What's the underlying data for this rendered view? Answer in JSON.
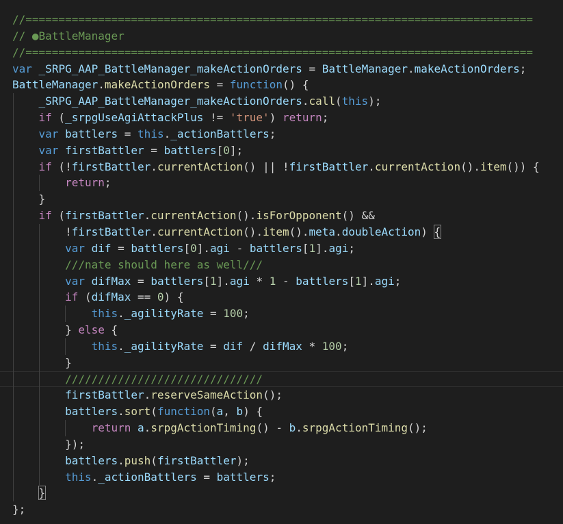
{
  "editor": {
    "language": "javascript",
    "theme": "Dark+",
    "background": "#1e1e1e",
    "colors": {
      "comment": "#6a9955",
      "keyword": "#569cd6",
      "control": "#c586c0",
      "variable": "#9cdcfe",
      "function": "#dcdcaa",
      "string": "#ce9178",
      "number": "#b5cea8",
      "type": "#4ec9b0",
      "plain": "#d4d4d4"
    },
    "lines": [
      {
        "indent": 0,
        "tokens": [
          {
            "t": "//=============================================================================",
            "c": "comment"
          }
        ]
      },
      {
        "indent": 0,
        "tokens": [
          {
            "t": "// ●BattleManager",
            "c": "comment"
          }
        ]
      },
      {
        "indent": 0,
        "tokens": [
          {
            "t": "//=============================================================================",
            "c": "comment"
          }
        ]
      },
      {
        "indent": 0,
        "tokens": [
          {
            "t": "var",
            "c": "keyword"
          },
          {
            "t": " ",
            "c": "plain"
          },
          {
            "t": "_SRPG_AAP_BattleManager_makeActionOrders",
            "c": "variable"
          },
          {
            "t": " = ",
            "c": "plain"
          },
          {
            "t": "BattleManager",
            "c": "variable"
          },
          {
            "t": ".",
            "c": "plain"
          },
          {
            "t": "makeActionOrders",
            "c": "variable"
          },
          {
            "t": ";",
            "c": "plain"
          }
        ]
      },
      {
        "indent": 0,
        "tokens": [
          {
            "t": "BattleManager",
            "c": "variable"
          },
          {
            "t": ".",
            "c": "plain"
          },
          {
            "t": "makeActionOrders",
            "c": "function"
          },
          {
            "t": " = ",
            "c": "plain"
          },
          {
            "t": "function",
            "c": "keyword"
          },
          {
            "t": "() {",
            "c": "plain"
          }
        ]
      },
      {
        "indent": 1,
        "tokens": [
          {
            "t": "_SRPG_AAP_BattleManager_makeActionOrders",
            "c": "variable"
          },
          {
            "t": ".",
            "c": "plain"
          },
          {
            "t": "call",
            "c": "function"
          },
          {
            "t": "(",
            "c": "plain"
          },
          {
            "t": "this",
            "c": "keyword"
          },
          {
            "t": ");",
            "c": "plain"
          }
        ]
      },
      {
        "indent": 1,
        "tokens": [
          {
            "t": "if",
            "c": "control"
          },
          {
            "t": " (",
            "c": "plain"
          },
          {
            "t": "_srpgUseAgiAttackPlus",
            "c": "variable"
          },
          {
            "t": " != ",
            "c": "plain"
          },
          {
            "t": "'true'",
            "c": "string"
          },
          {
            "t": ") ",
            "c": "plain"
          },
          {
            "t": "return",
            "c": "control"
          },
          {
            "t": ";",
            "c": "plain"
          }
        ]
      },
      {
        "indent": 1,
        "tokens": [
          {
            "t": "var",
            "c": "keyword"
          },
          {
            "t": " ",
            "c": "plain"
          },
          {
            "t": "battlers",
            "c": "variable"
          },
          {
            "t": " = ",
            "c": "plain"
          },
          {
            "t": "this",
            "c": "keyword"
          },
          {
            "t": ".",
            "c": "plain"
          },
          {
            "t": "_actionBattlers",
            "c": "variable"
          },
          {
            "t": ";",
            "c": "plain"
          }
        ]
      },
      {
        "indent": 1,
        "tokens": [
          {
            "t": "var",
            "c": "keyword"
          },
          {
            "t": " ",
            "c": "plain"
          },
          {
            "t": "firstBattler",
            "c": "variable"
          },
          {
            "t": " = ",
            "c": "plain"
          },
          {
            "t": "battlers",
            "c": "variable"
          },
          {
            "t": "[",
            "c": "plain"
          },
          {
            "t": "0",
            "c": "number"
          },
          {
            "t": "];",
            "c": "plain"
          }
        ]
      },
      {
        "indent": 1,
        "tokens": [
          {
            "t": "if",
            "c": "control"
          },
          {
            "t": " (!",
            "c": "plain"
          },
          {
            "t": "firstBattler",
            "c": "variable"
          },
          {
            "t": ".",
            "c": "plain"
          },
          {
            "t": "currentAction",
            "c": "function"
          },
          {
            "t": "() || !",
            "c": "plain"
          },
          {
            "t": "firstBattler",
            "c": "variable"
          },
          {
            "t": ".",
            "c": "plain"
          },
          {
            "t": "currentAction",
            "c": "function"
          },
          {
            "t": "().",
            "c": "plain"
          },
          {
            "t": "item",
            "c": "function"
          },
          {
            "t": "()) {",
            "c": "plain"
          }
        ]
      },
      {
        "indent": 2,
        "tokens": [
          {
            "t": "return",
            "c": "control"
          },
          {
            "t": ";",
            "c": "plain"
          }
        ]
      },
      {
        "indent": 1,
        "tokens": [
          {
            "t": "}",
            "c": "plain"
          }
        ]
      },
      {
        "indent": 1,
        "tokens": [
          {
            "t": "if",
            "c": "control"
          },
          {
            "t": " (",
            "c": "plain"
          },
          {
            "t": "firstBattler",
            "c": "variable"
          },
          {
            "t": ".",
            "c": "plain"
          },
          {
            "t": "currentAction",
            "c": "function"
          },
          {
            "t": "().",
            "c": "plain"
          },
          {
            "t": "isForOpponent",
            "c": "function"
          },
          {
            "t": "() &&",
            "c": "plain"
          }
        ]
      },
      {
        "indent": 2,
        "tokens": [
          {
            "t": "!",
            "c": "plain"
          },
          {
            "t": "firstBattler",
            "c": "variable"
          },
          {
            "t": ".",
            "c": "plain"
          },
          {
            "t": "currentAction",
            "c": "function"
          },
          {
            "t": "().",
            "c": "plain"
          },
          {
            "t": "item",
            "c": "function"
          },
          {
            "t": "().",
            "c": "plain"
          },
          {
            "t": "meta",
            "c": "variable"
          },
          {
            "t": ".",
            "c": "plain"
          },
          {
            "t": "doubleAction",
            "c": "variable"
          },
          {
            "t": ") ",
            "c": "plain"
          },
          {
            "t": "{",
            "c": "plain",
            "hl": true
          }
        ]
      },
      {
        "indent": 2,
        "tokens": [
          {
            "t": "var",
            "c": "keyword"
          },
          {
            "t": " ",
            "c": "plain"
          },
          {
            "t": "dif",
            "c": "variable"
          },
          {
            "t": " = ",
            "c": "plain"
          },
          {
            "t": "battlers",
            "c": "variable"
          },
          {
            "t": "[",
            "c": "plain"
          },
          {
            "t": "0",
            "c": "number"
          },
          {
            "t": "].",
            "c": "plain"
          },
          {
            "t": "agi",
            "c": "variable"
          },
          {
            "t": " - ",
            "c": "plain"
          },
          {
            "t": "battlers",
            "c": "variable"
          },
          {
            "t": "[",
            "c": "plain"
          },
          {
            "t": "1",
            "c": "number"
          },
          {
            "t": "].",
            "c": "plain"
          },
          {
            "t": "agi",
            "c": "variable"
          },
          {
            "t": ";",
            "c": "plain"
          }
        ]
      },
      {
        "indent": 2,
        "tokens": [
          {
            "t": "///nate should here as well///",
            "c": "comment"
          }
        ]
      },
      {
        "indent": 2,
        "tokens": [
          {
            "t": "var",
            "c": "keyword"
          },
          {
            "t": " ",
            "c": "plain"
          },
          {
            "t": "difMax",
            "c": "variable"
          },
          {
            "t": " = ",
            "c": "plain"
          },
          {
            "t": "battlers",
            "c": "variable"
          },
          {
            "t": "[",
            "c": "plain"
          },
          {
            "t": "1",
            "c": "number"
          },
          {
            "t": "].",
            "c": "plain"
          },
          {
            "t": "agi",
            "c": "variable"
          },
          {
            "t": " * ",
            "c": "plain"
          },
          {
            "t": "1",
            "c": "number"
          },
          {
            "t": " - ",
            "c": "plain"
          },
          {
            "t": "battlers",
            "c": "variable"
          },
          {
            "t": "[",
            "c": "plain"
          },
          {
            "t": "1",
            "c": "number"
          },
          {
            "t": "].",
            "c": "plain"
          },
          {
            "t": "agi",
            "c": "variable"
          },
          {
            "t": ";",
            "c": "plain"
          }
        ]
      },
      {
        "indent": 2,
        "tokens": [
          {
            "t": "if",
            "c": "control"
          },
          {
            "t": " (",
            "c": "plain"
          },
          {
            "t": "difMax",
            "c": "variable"
          },
          {
            "t": " == ",
            "c": "plain"
          },
          {
            "t": "0",
            "c": "number"
          },
          {
            "t": ") {",
            "c": "plain"
          }
        ]
      },
      {
        "indent": 3,
        "tokens": [
          {
            "t": "this",
            "c": "keyword"
          },
          {
            "t": ".",
            "c": "plain"
          },
          {
            "t": "_agilityRate",
            "c": "variable"
          },
          {
            "t": " = ",
            "c": "plain"
          },
          {
            "t": "100",
            "c": "number"
          },
          {
            "t": ";",
            "c": "plain"
          }
        ]
      },
      {
        "indent": 2,
        "tokens": [
          {
            "t": "} ",
            "c": "plain"
          },
          {
            "t": "else",
            "c": "control"
          },
          {
            "t": " {",
            "c": "plain"
          }
        ]
      },
      {
        "indent": 3,
        "tokens": [
          {
            "t": "this",
            "c": "keyword"
          },
          {
            "t": ".",
            "c": "plain"
          },
          {
            "t": "_agilityRate",
            "c": "variable"
          },
          {
            "t": " = ",
            "c": "plain"
          },
          {
            "t": "dif",
            "c": "variable"
          },
          {
            "t": " / ",
            "c": "plain"
          },
          {
            "t": "difMax",
            "c": "variable"
          },
          {
            "t": " * ",
            "c": "plain"
          },
          {
            "t": "100",
            "c": "number"
          },
          {
            "t": ";",
            "c": "plain"
          }
        ]
      },
      {
        "indent": 2,
        "tokens": [
          {
            "t": "}",
            "c": "plain"
          }
        ]
      },
      {
        "indent": 2,
        "current": true,
        "tokens": [
          {
            "t": "//////////////////////////////",
            "c": "comment"
          }
        ]
      },
      {
        "indent": 2,
        "tokens": [
          {
            "t": "firstBattler",
            "c": "variable"
          },
          {
            "t": ".",
            "c": "plain"
          },
          {
            "t": "reserveSameAction",
            "c": "function"
          },
          {
            "t": "();",
            "c": "plain"
          }
        ]
      },
      {
        "indent": 2,
        "tokens": [
          {
            "t": "battlers",
            "c": "variable"
          },
          {
            "t": ".",
            "c": "plain"
          },
          {
            "t": "sort",
            "c": "function"
          },
          {
            "t": "(",
            "c": "plain"
          },
          {
            "t": "function",
            "c": "keyword"
          },
          {
            "t": "(",
            "c": "plain"
          },
          {
            "t": "a",
            "c": "variable"
          },
          {
            "t": ", ",
            "c": "plain"
          },
          {
            "t": "b",
            "c": "variable"
          },
          {
            "t": ") {",
            "c": "plain"
          }
        ]
      },
      {
        "indent": 3,
        "tokens": [
          {
            "t": "return",
            "c": "control"
          },
          {
            "t": " ",
            "c": "plain"
          },
          {
            "t": "a",
            "c": "variable"
          },
          {
            "t": ".",
            "c": "plain"
          },
          {
            "t": "srpgActionTiming",
            "c": "function"
          },
          {
            "t": "() - ",
            "c": "plain"
          },
          {
            "t": "b",
            "c": "variable"
          },
          {
            "t": ".",
            "c": "plain"
          },
          {
            "t": "srpgActionTiming",
            "c": "function"
          },
          {
            "t": "();",
            "c": "plain"
          }
        ]
      },
      {
        "indent": 2,
        "tokens": [
          {
            "t": "});",
            "c": "plain"
          }
        ]
      },
      {
        "indent": 2,
        "tokens": [
          {
            "t": "battlers",
            "c": "variable"
          },
          {
            "t": ".",
            "c": "plain"
          },
          {
            "t": "push",
            "c": "function"
          },
          {
            "t": "(",
            "c": "plain"
          },
          {
            "t": "firstBattler",
            "c": "variable"
          },
          {
            "t": ");",
            "c": "plain"
          }
        ]
      },
      {
        "indent": 2,
        "tokens": [
          {
            "t": "this",
            "c": "keyword"
          },
          {
            "t": ".",
            "c": "plain"
          },
          {
            "t": "_actionBattlers",
            "c": "variable"
          },
          {
            "t": " = ",
            "c": "plain"
          },
          {
            "t": "battlers",
            "c": "variable"
          },
          {
            "t": ";",
            "c": "plain"
          }
        ]
      },
      {
        "indent": 1,
        "tokens": [
          {
            "t": "}",
            "c": "plain",
            "hl": true
          }
        ]
      },
      {
        "indent": 0,
        "tokens": [
          {
            "t": "};",
            "c": "plain"
          }
        ]
      }
    ]
  }
}
